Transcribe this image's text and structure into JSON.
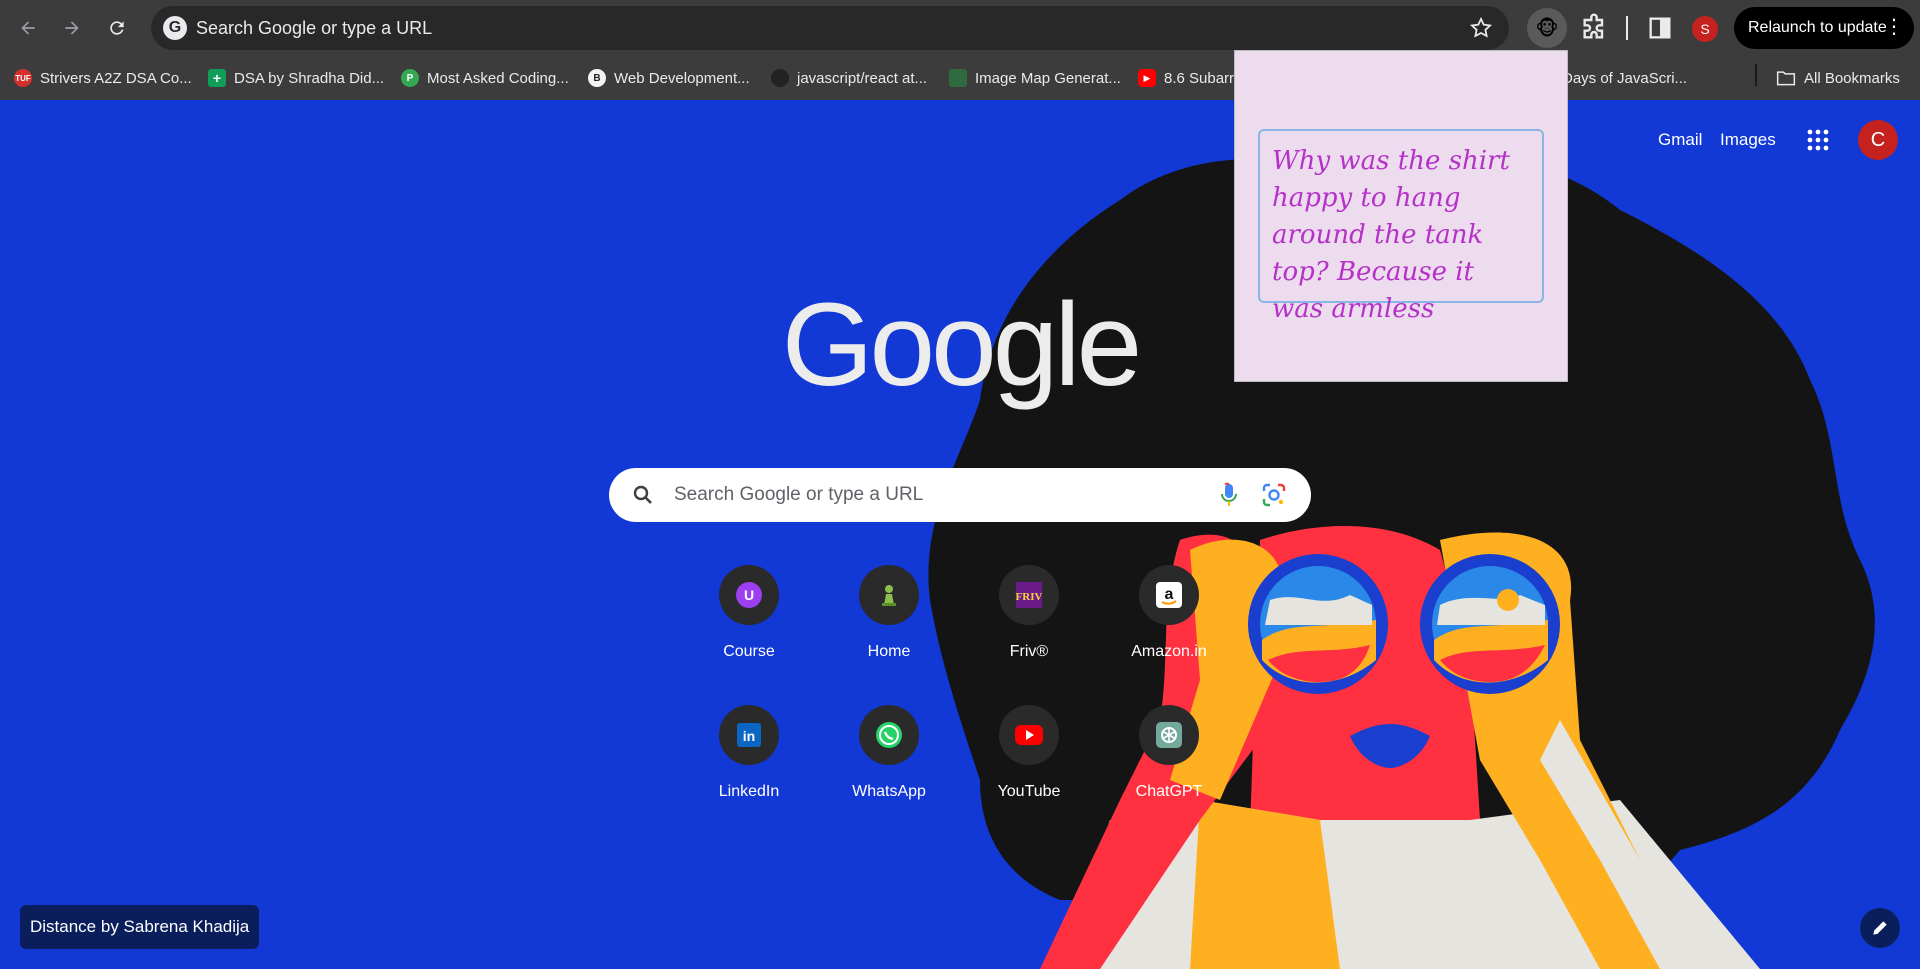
{
  "browser": {
    "omnibox_text": "Search Google or type a URL",
    "profile_initial": "S",
    "relaunch_label": "Relaunch to update",
    "bookmarks": [
      {
        "label": "Strivers A2Z DSA Co...",
        "fav_color": "#d32f2f",
        "fav_text": "TUF"
      },
      {
        "label": "DSA by Shradha Did...",
        "fav_color": "#0f9d58",
        "fav_text": "+"
      },
      {
        "label": "Most Asked Coding...",
        "fav_color": "#34a853",
        "fav_text": "P"
      },
      {
        "label": "Web Development...",
        "fav_color": "#f4f4f4",
        "fav_text": "B"
      },
      {
        "label": "javascript/react at...",
        "fav_color": "#222222",
        "fav_text": ""
      },
      {
        "label": "Image Map Generat...",
        "fav_color": "#2f6b3f",
        "fav_text": ""
      },
      {
        "label": "8.6 Subarr",
        "fav_color": "#ff0000",
        "fav_text": "▶"
      },
      {
        "label": "Days of JavaScri...",
        "fav_color": "#3c3c3c",
        "fav_text": ""
      }
    ],
    "all_bookmarks_label": "All Bookmarks"
  },
  "page": {
    "gmail_label": "Gmail",
    "images_label": "Images",
    "account_initial": "C",
    "logo_text": "Google",
    "search_placeholder": "Search Google or type a URL",
    "shortcuts": [
      {
        "label": "Course",
        "icon": "course-icon"
      },
      {
        "label": "Home",
        "icon": "chess-pawn-icon"
      },
      {
        "label": "Friv®",
        "icon": "friv-icon"
      },
      {
        "label": "Amazon.in",
        "icon": "amazon-icon"
      },
      {
        "label": "LinkedIn",
        "icon": "linkedin-icon"
      },
      {
        "label": "WhatsApp",
        "icon": "whatsapp-icon"
      },
      {
        "label": "YouTube",
        "icon": "youtube-icon"
      },
      {
        "label": "ChatGPT",
        "icon": "chatgpt-icon"
      }
    ],
    "theme_credit": "Distance by Sabrena Khadija"
  },
  "popup": {
    "joke": "Why was the shirt happy to hang around the tank top? Because it was armless"
  },
  "colors": {
    "background": "#1238d6",
    "chrome": "#3c3c3c",
    "joke_text": "#b531c7"
  }
}
